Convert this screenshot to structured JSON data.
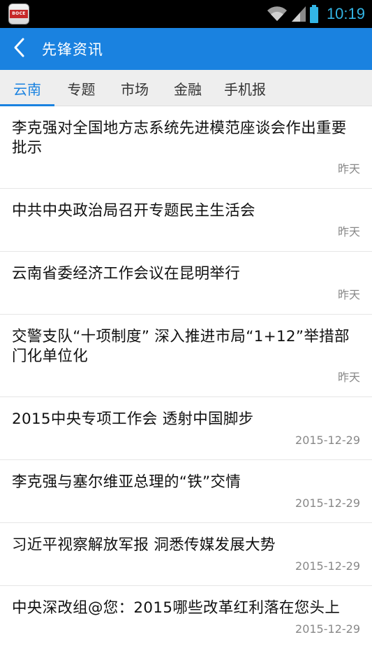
{
  "status_bar": {
    "time": "10:19",
    "app_icon_text": "BOCE"
  },
  "header": {
    "title": "先锋资讯",
    "back_icon": "chevron-left-icon"
  },
  "tabs": [
    {
      "label": "云南",
      "active": true
    },
    {
      "label": "专题",
      "active": false
    },
    {
      "label": "市场",
      "active": false
    },
    {
      "label": "金融",
      "active": false
    },
    {
      "label": "手机报",
      "active": false
    }
  ],
  "news": [
    {
      "title": "李克强对全国地方志系统先进模范座谈会作出重要批示",
      "date": "昨天"
    },
    {
      "title": "中共中央政治局召开专题民主生活会",
      "date": "昨天"
    },
    {
      "title": "云南省委经济工作会议在昆明举行",
      "date": "昨天"
    },
    {
      "title": "交警支队“十项制度” 深入推进市局“1+12”举措部门化单位化",
      "date": "昨天"
    },
    {
      "title": "2015中央专项工作会 透射中国脚步",
      "date": "2015-12-29"
    },
    {
      "title": "李克强与塞尔维亚总理的“铁”交情",
      "date": "2015-12-29"
    },
    {
      "title": "习近平视察解放军报 洞悉传媒发展大势",
      "date": "2015-12-29"
    },
    {
      "title": "中央深改组@您：2015哪些改革红利落在您头上",
      "date": "2015-12-29"
    }
  ],
  "colors": {
    "accent": "#1a82e0",
    "status_time": "#33b5e5"
  }
}
